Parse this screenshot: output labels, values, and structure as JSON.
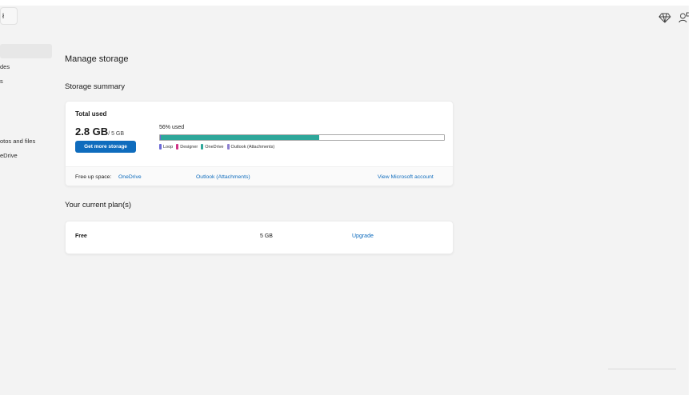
{
  "titlebar": {
    "button_label": "ł",
    "icons": [
      "premium-diamond-icon",
      "account-settings-icon"
    ]
  },
  "sidebar": {
    "items": [
      {
        "label": "des"
      },
      {
        "label": "s"
      },
      {
        "label": "otos and files"
      },
      {
        "label": "eDrive"
      }
    ]
  },
  "main": {
    "title": "Manage storage",
    "summary_heading": "Storage summary",
    "summary": {
      "total_label": "Total used",
      "used_value": "2.8 GB",
      "used_total": "/ 5 GB",
      "get_more_label": "Get more storage",
      "percent_label": "56% used",
      "percent_used": 0.56,
      "segments": [
        {
          "name": "Loop",
          "color": "#6b69d6",
          "fraction": 0.004
        },
        {
          "name": "Designer",
          "color": "#d13487",
          "fraction": 0.0
        },
        {
          "name": "OneDrive",
          "color": "#2ea79a",
          "fraction": 0.556
        },
        {
          "name": "Outlook (Attachments)",
          "color": "#8c7fd1",
          "fraction": 0.0
        }
      ],
      "legend": [
        {
          "label": "Loop",
          "color": "#6b69d6"
        },
        {
          "label": "Designer",
          "color": "#d13487"
        },
        {
          "label": "OneDrive",
          "color": "#2ea79a"
        },
        {
          "label": "Outlook (Attachments)",
          "color": "#8c7fd1"
        }
      ],
      "free_up_label": "Free up space:",
      "free_up_links": [
        "OneDrive",
        "Outlook (Attachments)"
      ],
      "account_link": "View Microsoft account"
    },
    "plans_heading": "Your current plan(s)",
    "plan": {
      "name": "Free",
      "size": "5 GB",
      "action": "Upgrade"
    }
  },
  "colors": {
    "accent": "#0f6cbd",
    "window_bg": "#f3f3f3",
    "card_bg": "#ffffff"
  }
}
